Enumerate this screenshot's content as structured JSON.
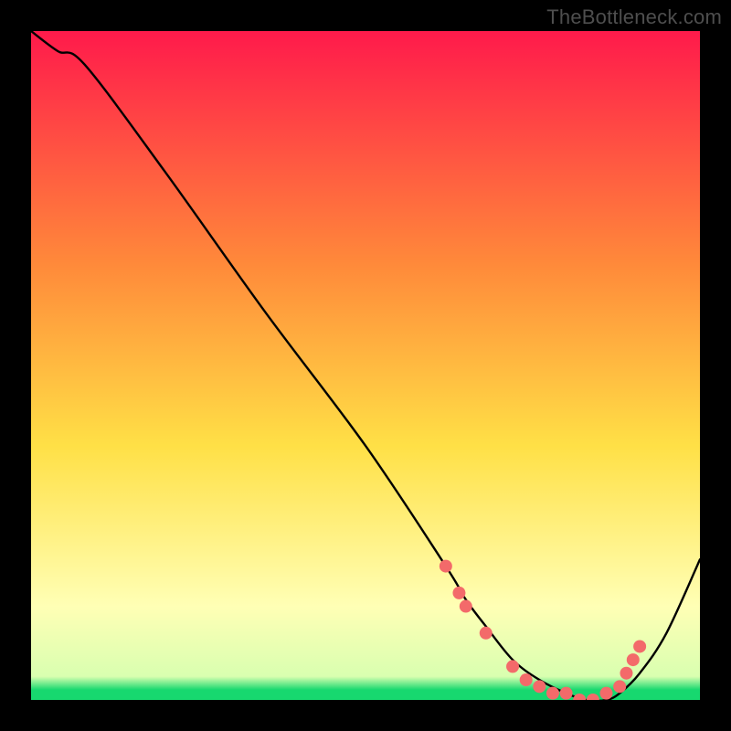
{
  "watermark": "TheBottleneck.com",
  "colors": {
    "frame": "#000000",
    "line": "#000000",
    "dot": "#f36a6a",
    "grad_top": "#ff1a4b",
    "grad_mid1": "#ff8a3a",
    "grad_mid2": "#ffe046",
    "grad_pale": "#ffffb5",
    "grad_green": "#17d86f"
  },
  "chart_data": {
    "type": "line",
    "title": "",
    "xlabel": "",
    "ylabel": "",
    "xlim": [
      0,
      100
    ],
    "ylim": [
      0,
      100
    ],
    "grid": false,
    "legend": false,
    "series": [
      {
        "name": "bottleneck-curve",
        "x": [
          0,
          4,
          8,
          20,
          35,
          50,
          62,
          65,
          68,
          72,
          76,
          80,
          83,
          86,
          88,
          91,
          95,
          100
        ],
        "values": [
          100,
          97,
          95,
          79,
          58,
          38,
          20,
          15,
          11,
          6,
          3,
          1,
          0,
          0,
          1,
          4,
          10,
          21
        ]
      }
    ],
    "markers": [
      {
        "x": 62,
        "y": 20
      },
      {
        "x": 64,
        "y": 16
      },
      {
        "x": 65,
        "y": 14
      },
      {
        "x": 68,
        "y": 10
      },
      {
        "x": 72,
        "y": 5
      },
      {
        "x": 74,
        "y": 3
      },
      {
        "x": 76,
        "y": 2
      },
      {
        "x": 78,
        "y": 1
      },
      {
        "x": 80,
        "y": 1
      },
      {
        "x": 82,
        "y": 0
      },
      {
        "x": 84,
        "y": 0
      },
      {
        "x": 86,
        "y": 1
      },
      {
        "x": 88,
        "y": 2
      },
      {
        "x": 89,
        "y": 4
      },
      {
        "x": 90,
        "y": 6
      },
      {
        "x": 91,
        "y": 8
      }
    ]
  }
}
